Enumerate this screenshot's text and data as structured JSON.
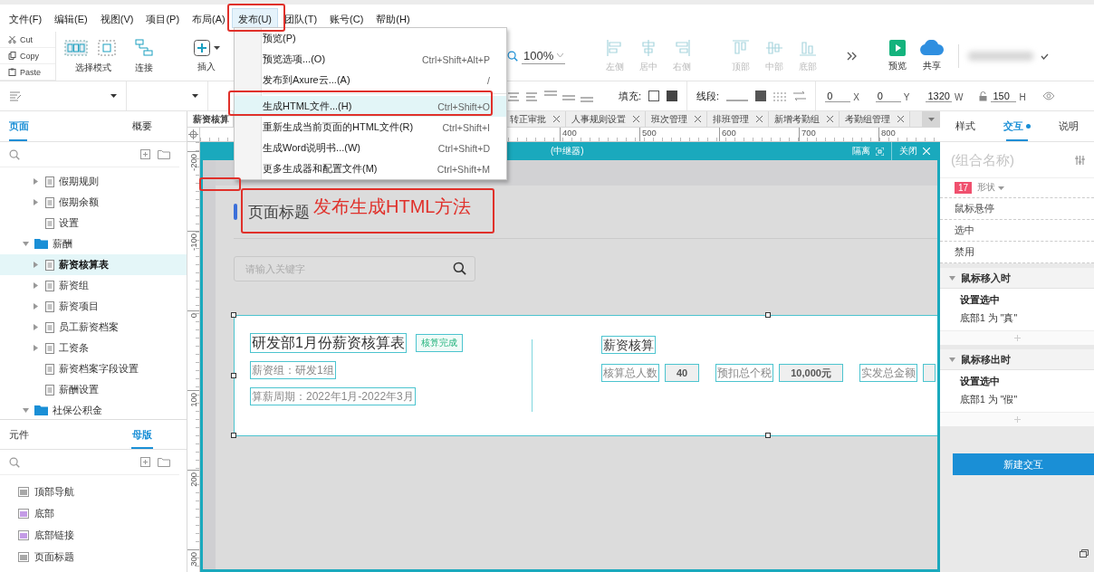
{
  "menubar": [
    {
      "label": "文件(F)",
      "selected": false
    },
    {
      "label": "编辑(E)",
      "selected": false
    },
    {
      "label": "视图(V)",
      "selected": false
    },
    {
      "label": "项目(P)",
      "selected": false
    },
    {
      "label": "布局(A)",
      "selected": false
    },
    {
      "label": "发布(U)",
      "selected": true
    },
    {
      "label": "团队(T)",
      "selected": false
    },
    {
      "label": "账号(C)",
      "selected": false
    },
    {
      "label": "帮助(H)",
      "selected": false
    }
  ],
  "toolbar": {
    "clipboard": [
      {
        "kind": "cut",
        "label": "Cut"
      },
      {
        "kind": "copy",
        "label": "Copy"
      },
      {
        "kind": "paste",
        "label": "Paste"
      }
    ],
    "tools": [
      {
        "kind": "select",
        "label": "选择模式"
      },
      {
        "kind": "connect",
        "label": "连接"
      },
      {
        "kind": "insert",
        "label": "插入"
      }
    ],
    "zoom": "100%",
    "align": [
      {
        "kind": "left",
        "label": "左侧",
        "disabled": true
      },
      {
        "kind": "center",
        "label": "居中",
        "disabled": true
      },
      {
        "kind": "right",
        "label": "右侧",
        "disabled": true
      },
      {
        "kind": "top",
        "label": "顶部",
        "disabled": true
      },
      {
        "kind": "middle",
        "label": "中部",
        "disabled": true
      },
      {
        "kind": "bottom",
        "label": "底部",
        "disabled": true
      }
    ],
    "actions": [
      {
        "kind": "preview",
        "label": "预览"
      },
      {
        "kind": "share",
        "label": "共享"
      }
    ]
  },
  "format_bar": {
    "fill_label": "填充:",
    "stroke_label": "线段:",
    "fields": [
      {
        "label": "X",
        "value": "0"
      },
      {
        "label": "Y",
        "value": "0"
      },
      {
        "label": "W",
        "value": "1320"
      },
      {
        "label": "H",
        "value": "150"
      }
    ]
  },
  "pages": {
    "tabs": [
      {
        "label": "页面",
        "selected": true
      },
      {
        "label": "概要",
        "selected": false
      }
    ],
    "tree": [
      {
        "kind": "page",
        "label": "假期规则",
        "expanded": false,
        "selected": false
      },
      {
        "kind": "page",
        "label": "假期余额",
        "expanded": false,
        "selected": false
      },
      {
        "kind": "page",
        "label": "设置",
        "selected": false
      },
      {
        "kind": "folder",
        "label": "薪酬",
        "expanded": true,
        "selected": false,
        "children": [
          {
            "kind": "page",
            "label": "薪资核算表",
            "expanded": false,
            "selected": true
          },
          {
            "kind": "page",
            "label": "薪资组",
            "expanded": false,
            "selected": false
          },
          {
            "kind": "page",
            "label": "薪资项目",
            "expanded": false,
            "selected": false
          },
          {
            "kind": "page",
            "label": "员工薪资档案",
            "expanded": false,
            "selected": false
          },
          {
            "kind": "page",
            "label": "工资条",
            "expanded": false,
            "selected": false
          },
          {
            "kind": "page",
            "label": "薪资档案字段设置",
            "selected": false
          },
          {
            "kind": "page",
            "label": "薪酬设置",
            "selected": false
          }
        ]
      },
      {
        "kind": "folder",
        "label": "社保公积金",
        "expanded": true,
        "selected": false
      }
    ]
  },
  "masters": {
    "tabs": [
      {
        "label": "元件",
        "selected": false
      },
      {
        "label": "母版",
        "selected": true
      }
    ],
    "items": [
      {
        "label": "顶部导航",
        "color": "#a8a8a8"
      },
      {
        "label": "底部",
        "color": "#c49be6"
      },
      {
        "label": "底部链接",
        "color": "#c49be6"
      },
      {
        "label": "页面标题",
        "color": "#a8a8a8"
      }
    ]
  },
  "doc_tabs": [
    {
      "label": "薪资核算",
      "selected": true
    },
    {
      "label": "转正审批",
      "selected": false
    },
    {
      "label": "人事规则设置",
      "selected": false
    },
    {
      "label": "班次管理",
      "selected": false
    },
    {
      "label": "排班管理",
      "selected": false
    },
    {
      "label": "新增考勤组",
      "selected": false
    },
    {
      "label": "考勤组管理",
      "selected": false
    }
  ],
  "ruler": {
    "horizontal": [
      "400",
      "500",
      "600",
      "700",
      "800"
    ],
    "vertical": [
      "-200",
      "-100",
      "0",
      "100",
      "200",
      "300"
    ]
  },
  "canvas": {
    "repeater_bar": {
      "title": "(中继器)",
      "isolate": "隔离",
      "close": "关闭"
    },
    "page_title": "页面标题",
    "search": {
      "placeholder": "请输入关键字"
    },
    "card": {
      "title": "研发部1月份薪资核算表",
      "badge": "核算完成",
      "group": "薪资组：研发1组",
      "period": "算薪周期：2022年1月-2022年3月",
      "summary_title": "薪资核算",
      "stats": [
        {
          "label": "核算总人数",
          "value": "40"
        },
        {
          "label": "预扣总个税",
          "value": "10,000元"
        },
        {
          "label": "实发总金额"
        }
      ]
    }
  },
  "inspector": {
    "tabs": [
      {
        "label": "样式",
        "selected": false
      },
      {
        "label": "交互",
        "selected": true
      },
      {
        "label": "说明",
        "selected": false
      }
    ],
    "name": {
      "placeholder": "(组合名称)"
    },
    "count": "17",
    "shape": "形状",
    "states": [
      "鼠标悬停",
      "选中",
      "禁用"
    ],
    "events": [
      {
        "title": "鼠标移入时",
        "expanded": true,
        "action": "设置选中",
        "detail": "底部1 为 \"真\""
      },
      {
        "title": "鼠标移出时",
        "expanded": true,
        "action": "设置选中",
        "detail": "底部1 为 \"假\""
      }
    ],
    "new_button": "新建交互"
  },
  "publish_menu": [
    {
      "kind": "item",
      "label": "预览(P)",
      "selected": false
    },
    {
      "kind": "item",
      "label": "预览选项...(O)",
      "shortcut": "Ctrl+Shift+Alt+P",
      "selected": false
    },
    {
      "kind": "item",
      "label": "发布到Axure云...(A)",
      "shortcut": "/",
      "selected": false
    },
    {
      "kind": "separator"
    },
    {
      "kind": "item",
      "label": "生成HTML文件...(H)",
      "shortcut": "Ctrl+Shift+O",
      "selected": true
    },
    {
      "kind": "item",
      "label": "重新生成当前页面的HTML文件(R)",
      "shortcut": "Ctrl+Shift+I",
      "selected": false
    },
    {
      "kind": "item",
      "label": "生成Word说明书...(W)",
      "shortcut": "Ctrl+Shift+D",
      "selected": false
    },
    {
      "kind": "item",
      "label": "更多生成器和配置文件(M)",
      "shortcut": "Ctrl+Shift+M",
      "selected": false
    }
  ],
  "annotation": {
    "text": "发布生成HTML方法"
  }
}
